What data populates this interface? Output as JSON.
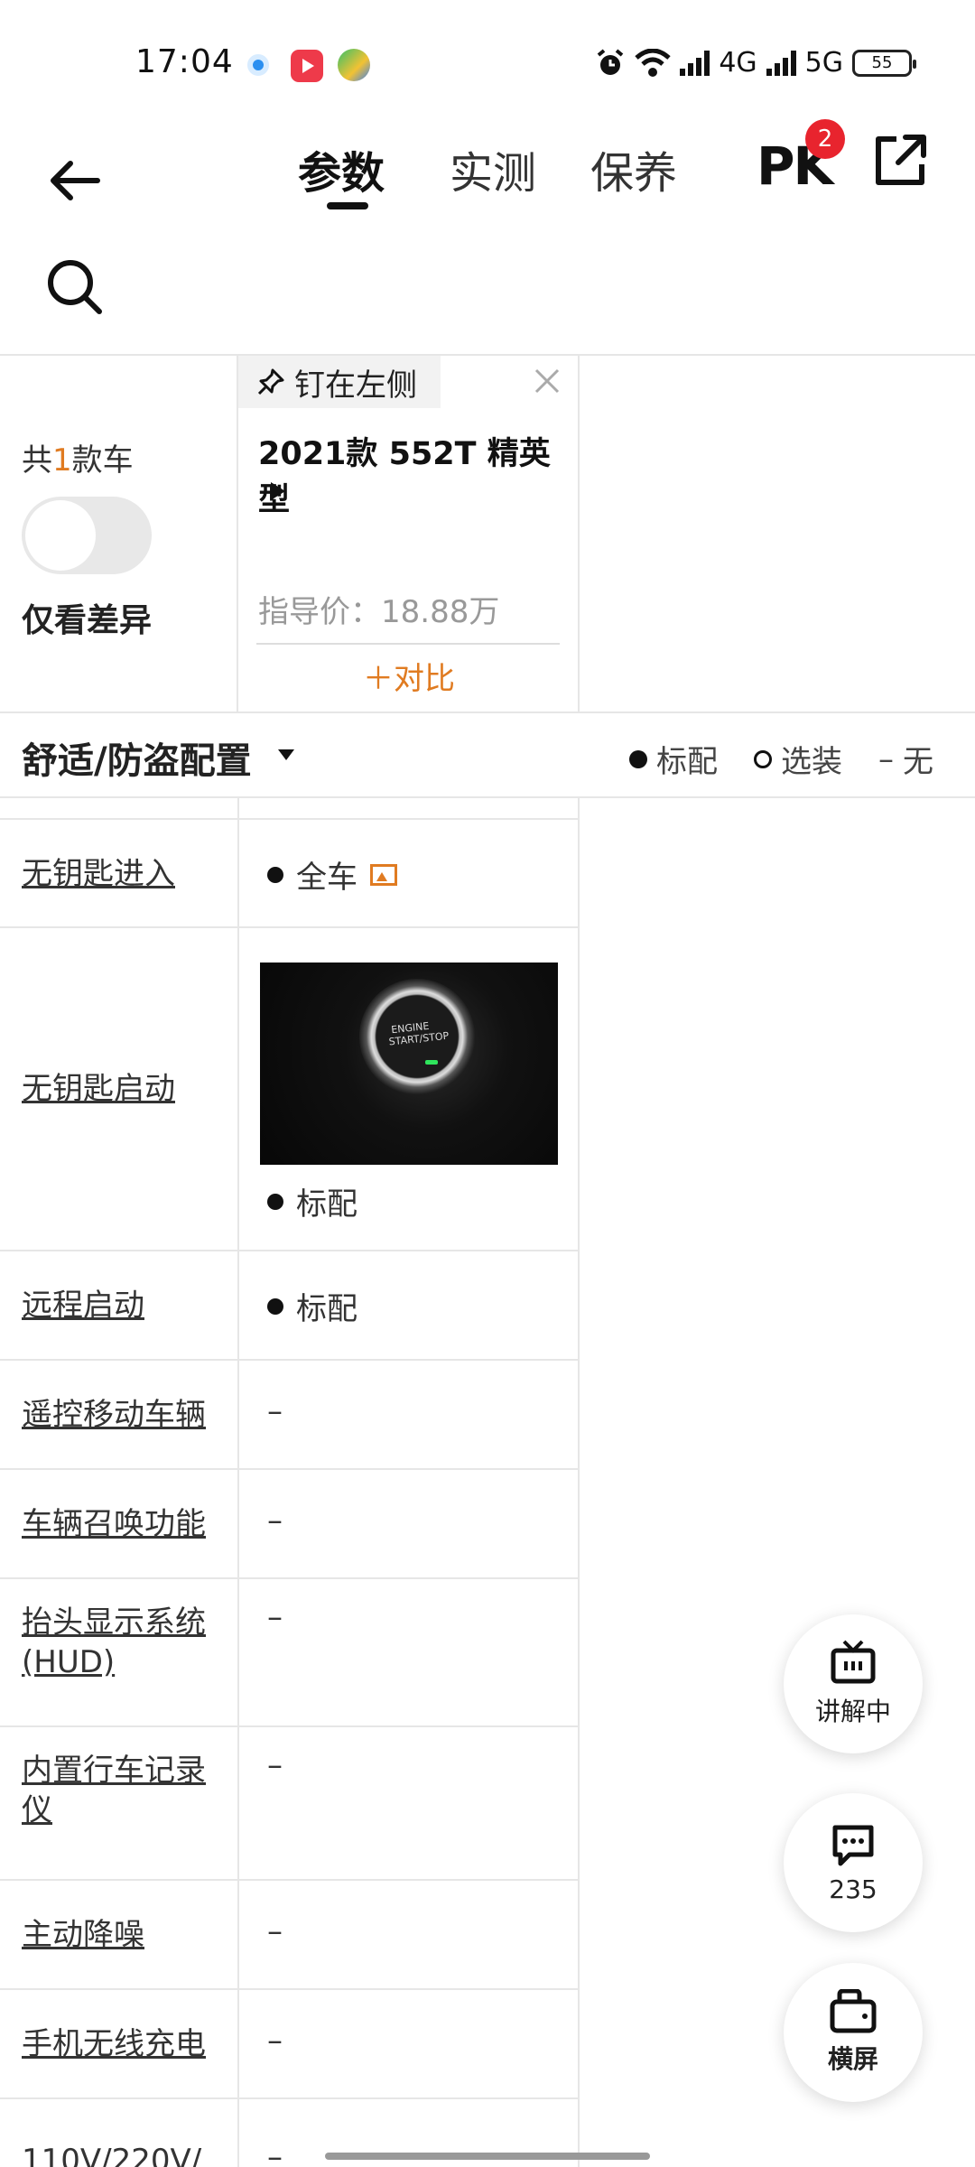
{
  "status": {
    "time": "17:04",
    "net1": "4G",
    "net2": "5G",
    "battery": "55"
  },
  "nav": {
    "tabs": [
      "参数",
      "实测",
      "保养"
    ],
    "pk": "PK",
    "pk_badge": "2"
  },
  "header": {
    "count_prefix": "共",
    "count_num": "1",
    "count_suffix": "款车",
    "diff_label": "仅看差异",
    "pin_label": "钉在左侧",
    "car_name": "2021款 552T 精英型",
    "price": "指导价：18.88万",
    "compare": "＋对比"
  },
  "section": {
    "title": "舒适/防盗配置",
    "legend_std": "标配",
    "legend_opt": "选装",
    "legend_none": "无"
  },
  "rows": [
    {
      "label": "无钥匙进入",
      "value": "全车"
    },
    {
      "label": "无钥匙启动",
      "value": "标配",
      "photo_text": "ENGINE START/STOP"
    },
    {
      "label": "远程启动",
      "value": "标配"
    },
    {
      "label": "遥控移动车辆",
      "value": "–"
    },
    {
      "label": "车辆召唤功能",
      "value": "–"
    },
    {
      "label": "抬头显示系统(HUD)",
      "value": "–"
    },
    {
      "label": "内置行车记录仪",
      "value": "–"
    },
    {
      "label": "主动降噪",
      "value": "–"
    },
    {
      "label": "手机无线充电",
      "value": "–"
    },
    {
      "label": "110V/220V/",
      "value": "–"
    }
  ],
  "fabs": {
    "explain": "讲解中",
    "comments": "235",
    "landscape": "横屏"
  }
}
